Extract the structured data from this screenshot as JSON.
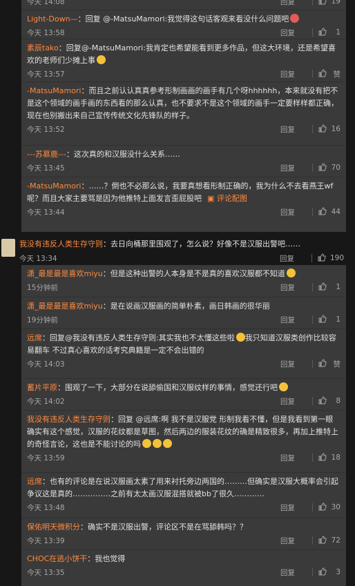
{
  "reply_label": "回复",
  "block_a": [
    {
      "time": "今天 14:08",
      "likes": "19"
    },
    {
      "name": "Light-Down—",
      "text": "：回复 @-MatsuMamori:我觉得这句话客观来看没什么问题吧",
      "emoji": true,
      "emoji_red": true,
      "time": "今天 13:58",
      "likes": "1"
    },
    {
      "name": "素辰tako",
      "text": "：回复@-MatsuMamori:我肯定也希望能看到更多作品，但这大环境，还是希望喜欢的老师们少摊上事",
      "emoji": true,
      "time": "今天 13:57",
      "likes": "赞"
    },
    {
      "name": "-MatsuMamori",
      "text": "：而且之前认认真真参考形制画画的画手有几个呀hhhhhh，本来就没有把不是这个领域的画手画的东西看的那么认真，也不要求不是这个领域的画手一定要样样都正确，现在也别搬出来自己宣传传统文化先锋队的样子。",
      "time": "今天 13:52",
      "likes": "16"
    },
    {
      "name": "---苏慕鹿---",
      "text": "：这次真的和汉服没什么关系……",
      "time": "今天 13:45",
      "likes": "70"
    },
    {
      "name": "-MatsuMamori",
      "text": "：……？倒也不必那么说，我要真想看形制正确的，我为什么不去看燕王wf呢？而且大家主要骂是因为他推特上面发言歪屁股吧",
      "pic": "评论配图",
      "time": "今天 13:44",
      "likes": "44"
    }
  ],
  "main_comment": {
    "name": "我没有违反人类生存守则",
    "text": "：去日向桶那里围观了，怎么说？好像不是汉服出警吧……",
    "time": "今天 13:34",
    "likes": "190"
  },
  "block_b": [
    {
      "name": "潇_最是最是喜欢miyu",
      "text": "：但是这种出警的人本身是不是真的喜欢汉服都不知道",
      "emoji": true,
      "time": "15分钟前",
      "likes": "1"
    },
    {
      "name": "潇_最是最是喜欢miyu",
      "text": "：是在说画汉服画的简单朴素，画日韩画的很华丽",
      "time": "19分钟前",
      "likes": "1"
    },
    {
      "name": "远席",
      "text": "：回复@我没有违反人类生存守则:其实我也不太懂这些啦",
      "emoji": true,
      "text2": "我只知道汉服类创作比较容易翻车 不过真心喜欢的话考究典籍是一定不会出错的",
      "time": "今天 14:03",
      "likes": "赞"
    },
    {
      "name": "蓄片平原",
      "text": "：围观了一下，大部分在说舔偷国和汉服纹样的事情，感觉还行吧",
      "emoji": true,
      "time": "今天 14:02",
      "likes": "8"
    },
    {
      "name": "我没有违反人类生存守则",
      "text": "：回复 @远席:啊 我不是汉服党 形制我看不懂，但是我看到第一眼确实有这个感觉，汉服的花纹都是草图，然后两边的服装花纹的确是精致很多，再加上推特上的奇怪言论，这也是不能讨论的吗",
      "emoji3": true,
      "time": "今天 13:59",
      "likes": "18"
    },
    {
      "name": "远席",
      "text": "：也有的评论是在说汉服画太素了用来衬托旁边两国的………但确实是汉服大概率会引起争议这是真的……………之前有太太画汉服混搭就被bb了很久…………",
      "time": "今天 13:48",
      "likes": "30"
    },
    {
      "name": "保佑明天微积分",
      "text": "：确实不是汉服出警，评论区不是在骂舔韩吗？？",
      "time": "今天 13:39",
      "likes": "72"
    },
    {
      "name": "CHOC在逃小饼干",
      "text": "：我也觉得",
      "time": "今天 13:35",
      "likes": "3"
    }
  ]
}
